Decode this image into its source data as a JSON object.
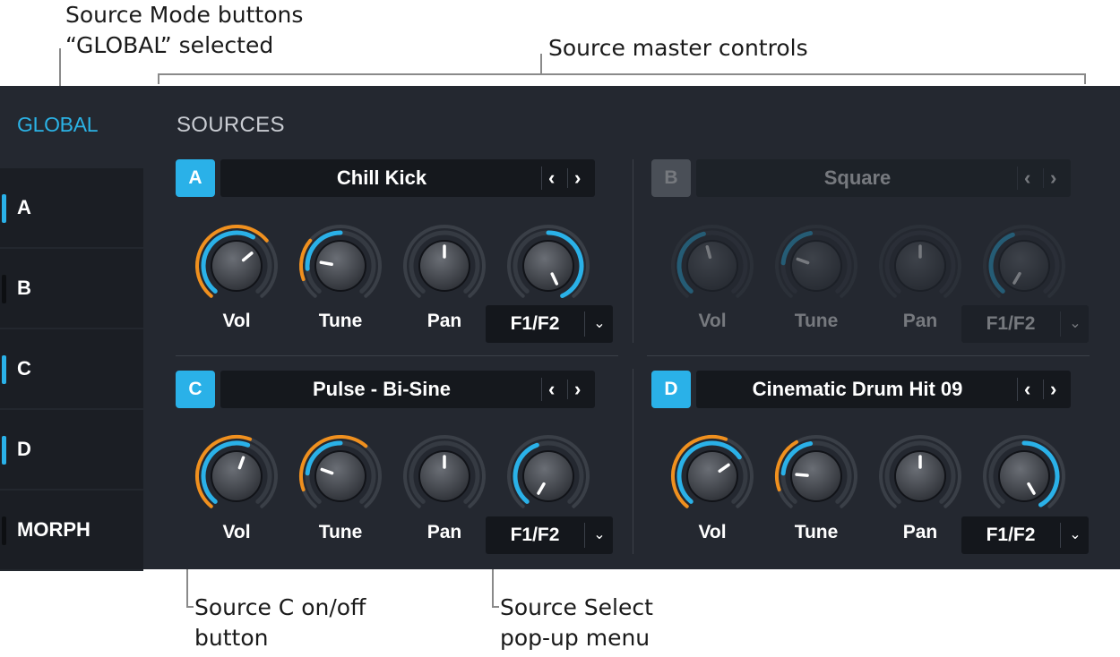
{
  "callouts": {
    "source_mode_line1": "Source Mode buttons",
    "source_mode_line2": "“GLOBAL” selected",
    "master_controls": "Source master controls",
    "source_c_line1": "Source C on/off",
    "source_c_line2": "button",
    "source_select_line1": "Source Select",
    "source_select_line2": "pop-up menu"
  },
  "sidebar": {
    "global_label": "GLOBAL",
    "items": [
      {
        "label": "A",
        "active": true
      },
      {
        "label": "B",
        "active": false
      },
      {
        "label": "C",
        "active": true
      },
      {
        "label": "D",
        "active": true
      },
      {
        "label": "MORPH",
        "active": false
      }
    ]
  },
  "sources_title": "SOURCES",
  "colors": {
    "accent_blue": "#2ab1e8",
    "accent_orange": "#f0901e",
    "panel_bg": "#242830"
  },
  "sources": [
    {
      "letter": "A",
      "name": "Chill Kick",
      "enabled": true,
      "knobs": [
        {
          "label": "Vol"
        },
        {
          "label": "Tune"
        },
        {
          "label": "Pan"
        }
      ],
      "filter": "F1/F2"
    },
    {
      "letter": "B",
      "name": "Square",
      "enabled": false,
      "knobs": [
        {
          "label": "Vol"
        },
        {
          "label": "Tune"
        },
        {
          "label": "Pan"
        }
      ],
      "filter": "F1/F2"
    },
    {
      "letter": "C",
      "name": "Pulse - Bi-Sine",
      "enabled": true,
      "knobs": [
        {
          "label": "Vol"
        },
        {
          "label": "Tune"
        },
        {
          "label": "Pan"
        }
      ],
      "filter": "F1/F2"
    },
    {
      "letter": "D",
      "name": "Cinematic Drum Hit 09",
      "enabled": true,
      "knobs": [
        {
          "label": "Vol"
        },
        {
          "label": "Tune"
        },
        {
          "label": "Pan"
        }
      ],
      "filter": "F1/F2"
    }
  ],
  "arrow_prev": "‹",
  "arrow_next": "›",
  "dropdown_chevron": "⌄"
}
